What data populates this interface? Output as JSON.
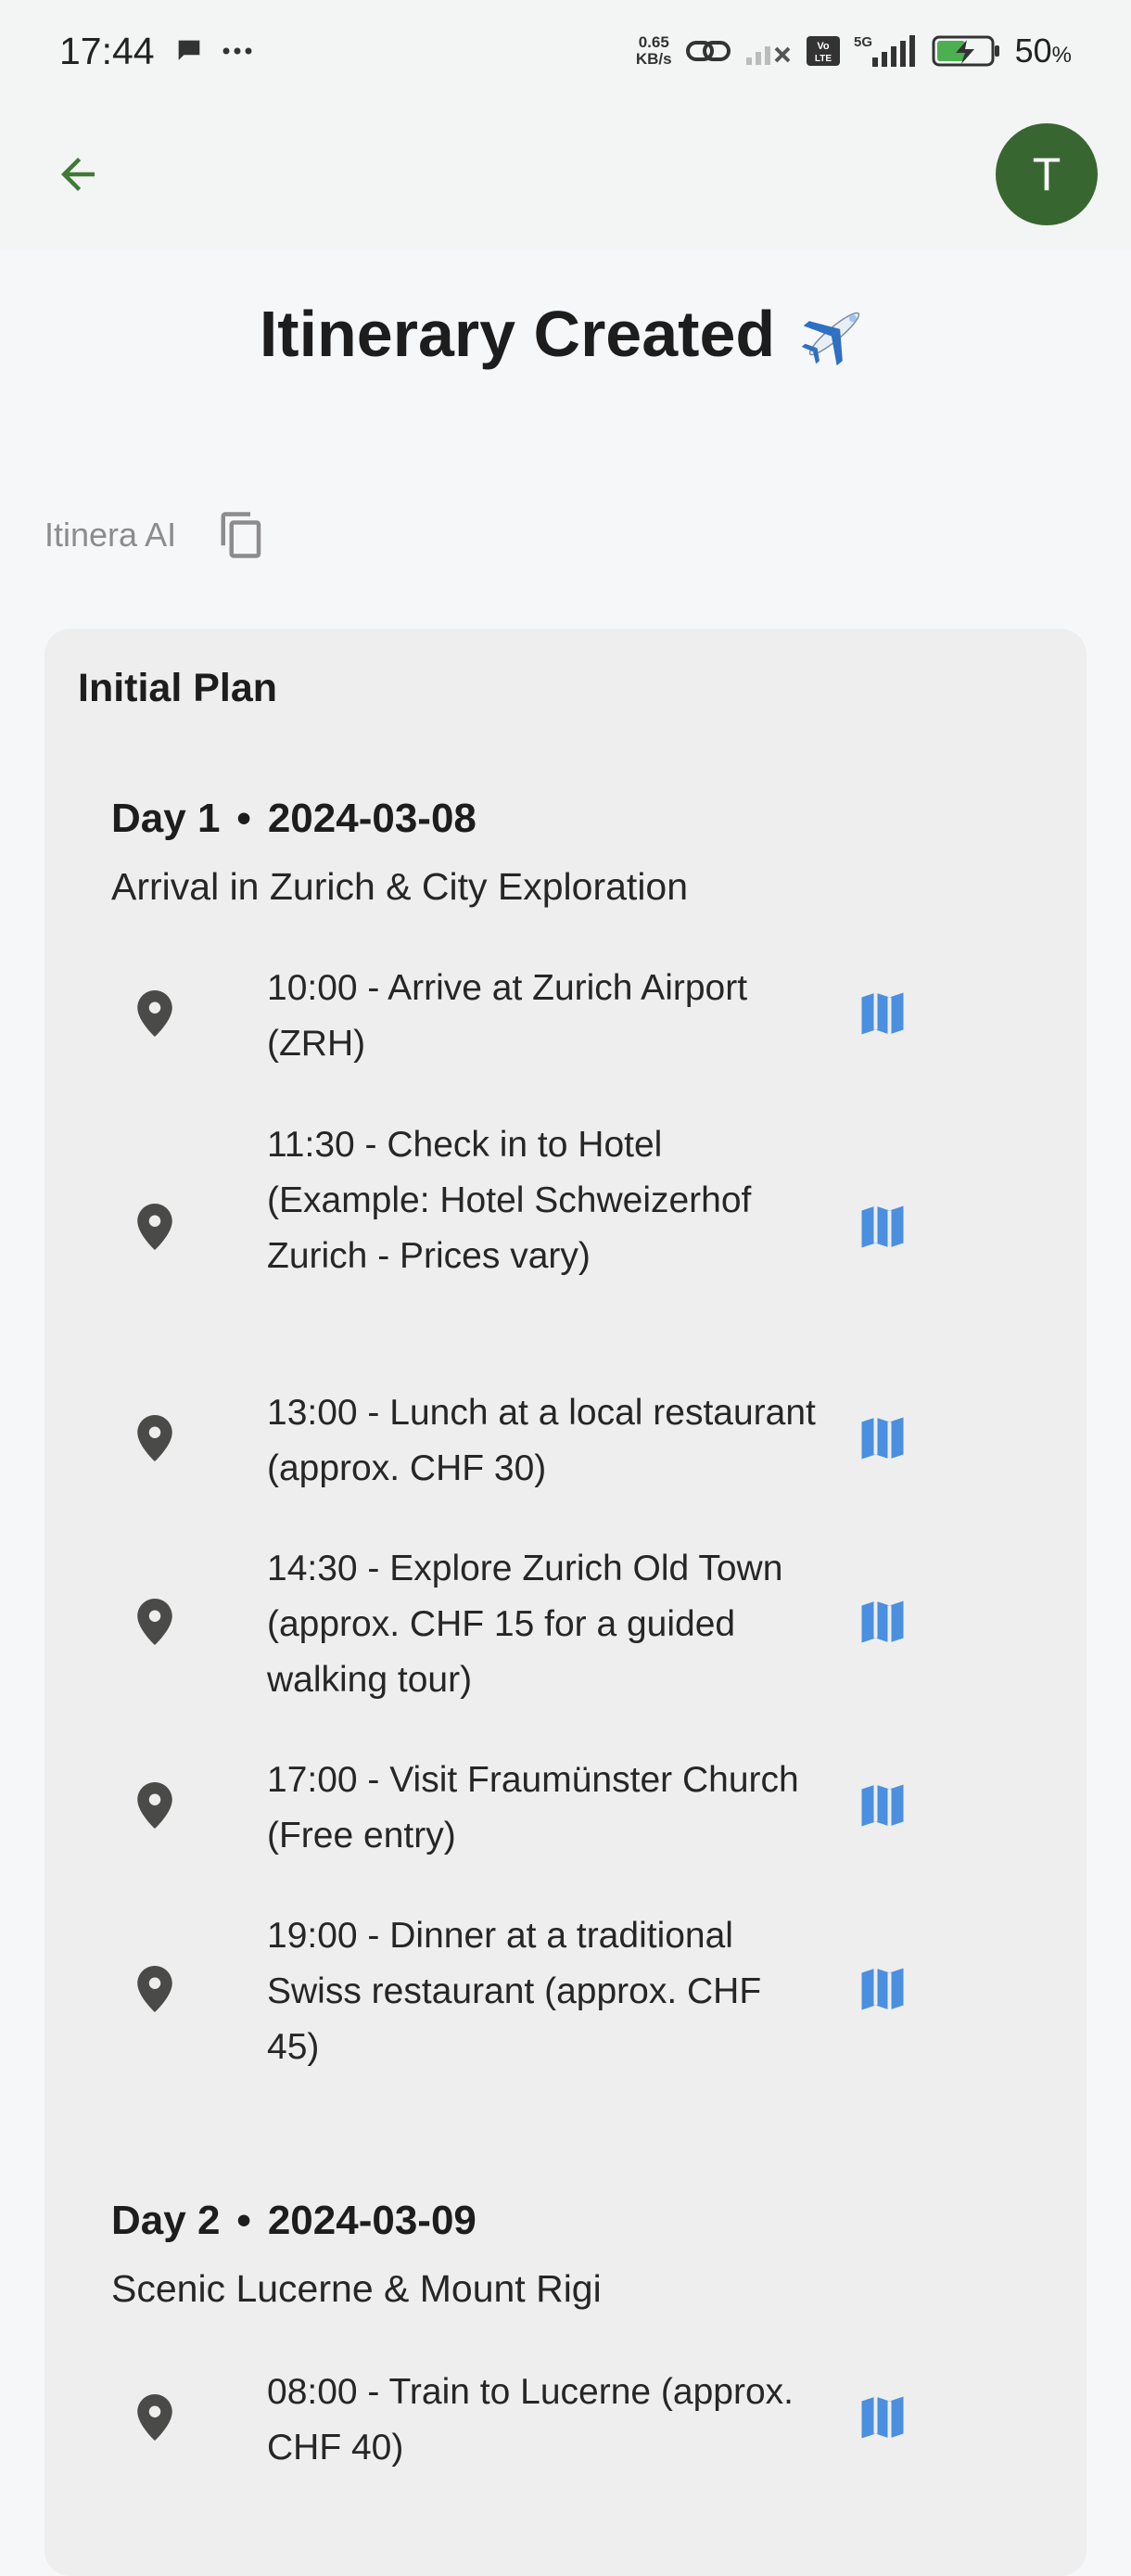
{
  "status_bar": {
    "time": "17:44",
    "speed_value": "0.65",
    "speed_unit": "KB/s",
    "network": "5G",
    "volte": "Vo LTE",
    "battery_percent": "50",
    "battery_unit": "%"
  },
  "app_bar": {
    "back_icon": "arrow-left-icon",
    "avatar_initial": "T",
    "avatar_color": "#386631"
  },
  "page": {
    "title": "Itinerary Created",
    "title_emoji_icon": "airplane-icon",
    "source_label": "Itinera AI",
    "copy_icon": "copy-icon"
  },
  "plan": {
    "title": "Initial Plan",
    "days": [
      {
        "day_label": "Day 1",
        "date": "2024-03-08",
        "subtitle": "Arrival in Zurich & City Exploration",
        "activities": [
          "10:00 - Arrive at Zurich Airport (ZRH)",
          "11:30 - Check in to Hotel (Example: Hotel Schweizerhof Zurich - Prices vary)",
          "13:00 - Lunch at a local restaurant (approx. CHF 30)",
          "14:30 - Explore Zurich Old Town (approx. CHF 15 for a guided walking tour)",
          "17:00 - Visit Fraumünster Church (Free entry)",
          "19:00 - Dinner at a traditional Swiss restaurant (approx. CHF 45)"
        ]
      },
      {
        "day_label": "Day 2",
        "date": "2024-03-09",
        "subtitle": "Scenic Lucerne & Mount Rigi",
        "activities": [
          "08:00 - Train to Lucerne (approx. CHF 40)"
        ]
      }
    ]
  },
  "colors": {
    "accent_green": "#386631",
    "back_arrow": "#3f7a37",
    "map_icon_blue": "#4a8fe0",
    "pin_gray": "#4a4a48"
  }
}
